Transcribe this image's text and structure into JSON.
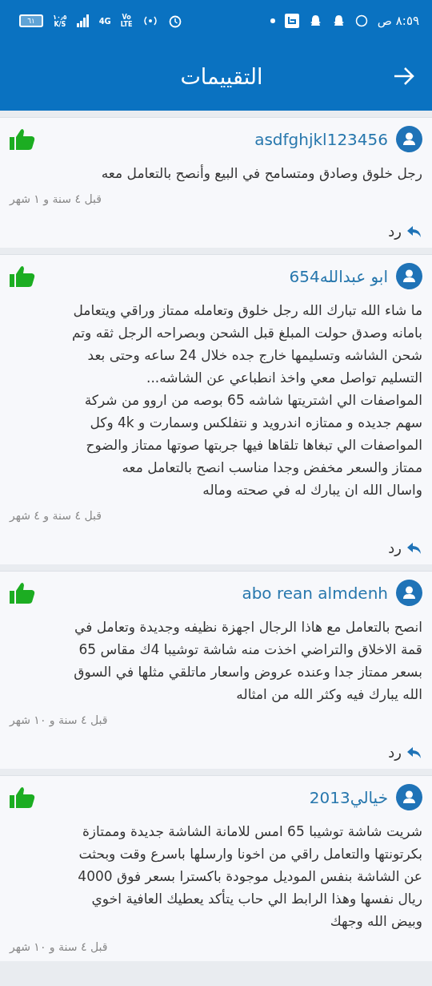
{
  "status_bar": {
    "time": "٨:٥٩ ص",
    "battery": "٦١",
    "speed": "١٠٫٥",
    "speed_unit": "K/S",
    "network": "4G",
    "volte_top": "Vo",
    "volte_bottom": "LTE"
  },
  "header": {
    "title": "التقييمات"
  },
  "reviews": [
    {
      "user": "asdfghjkl123456",
      "text": "رجل خلوق وصادق ومتسامح في البيع وأنصح بالتعامل معه",
      "time": "قبل ٤ سنة و ١ شهر",
      "reply": "رد"
    },
    {
      "user": "ابو عبدالله654",
      "text": "ما شاء الله تبارك الله رجل خلوق وتعامله ممتاز وراقي ويتعامل\nبامانه وصدق حولت المبلغ قبل الشحن وبصراحه الرجل ثقه وتم\nشحن الشاشه وتسليمها خارج جده خلال 24 ساعه وحتى بعد\nالتسليم تواصل معي واخذ انطباعي عن الشاشه...\nالمواصفات الي اشتريتها شاشه 65 بوصه من اروو من شركة\nسهم جديده و ممتازه اندرويد و نتفلكس وسمارت و 4k وكل\nالمواصفات الي تبغاها تلقاها فيها جربتها صوتها ممتاز والضوح\nممتاز  والسعر مخفض وجدا  مناسب انصح بالتعامل معه\nواسال الله ان يبارك له في صحته وماله",
      "time": "قبل ٤ سنة و ٤ شهر",
      "reply": "رد"
    },
    {
      "user": "abo rean almdenh",
      "text": "انصح بالتعامل مع هاذا الرجال اجهزة نظيفه وجديدة وتعامل في\nقمة الاخلاق والتراضي اخذت منه شاشة توشيبا 4ك مقاس 65\nبسعر ممتاز جدا وعنده عروض واسعار ماتلقي مثلها في السوق\nالله يبارك فيه وكثر الله من امثاله",
      "time": "قبل ٤ سنة و ١٠ شهر",
      "reply": "رد"
    },
    {
      "user": "خيالي2013",
      "text": "شريت شاشة توشيبا 65 امس للامانة الشاشة جديدة وممتازة\nبكرتونتها والتعامل راقي من اخونا وارسلها باسرع وقت وبحثت\nعن الشاشة بنفس الموديل موجودة باكسترا بسعر فوق 4000\nريال نفسها وهذا الرابط الي حاب يتأكد   يعطيك العافية اخوي\nوبيض الله وجهك",
      "time": "قبل ٤ سنة و ١٠ شهر"
    }
  ]
}
